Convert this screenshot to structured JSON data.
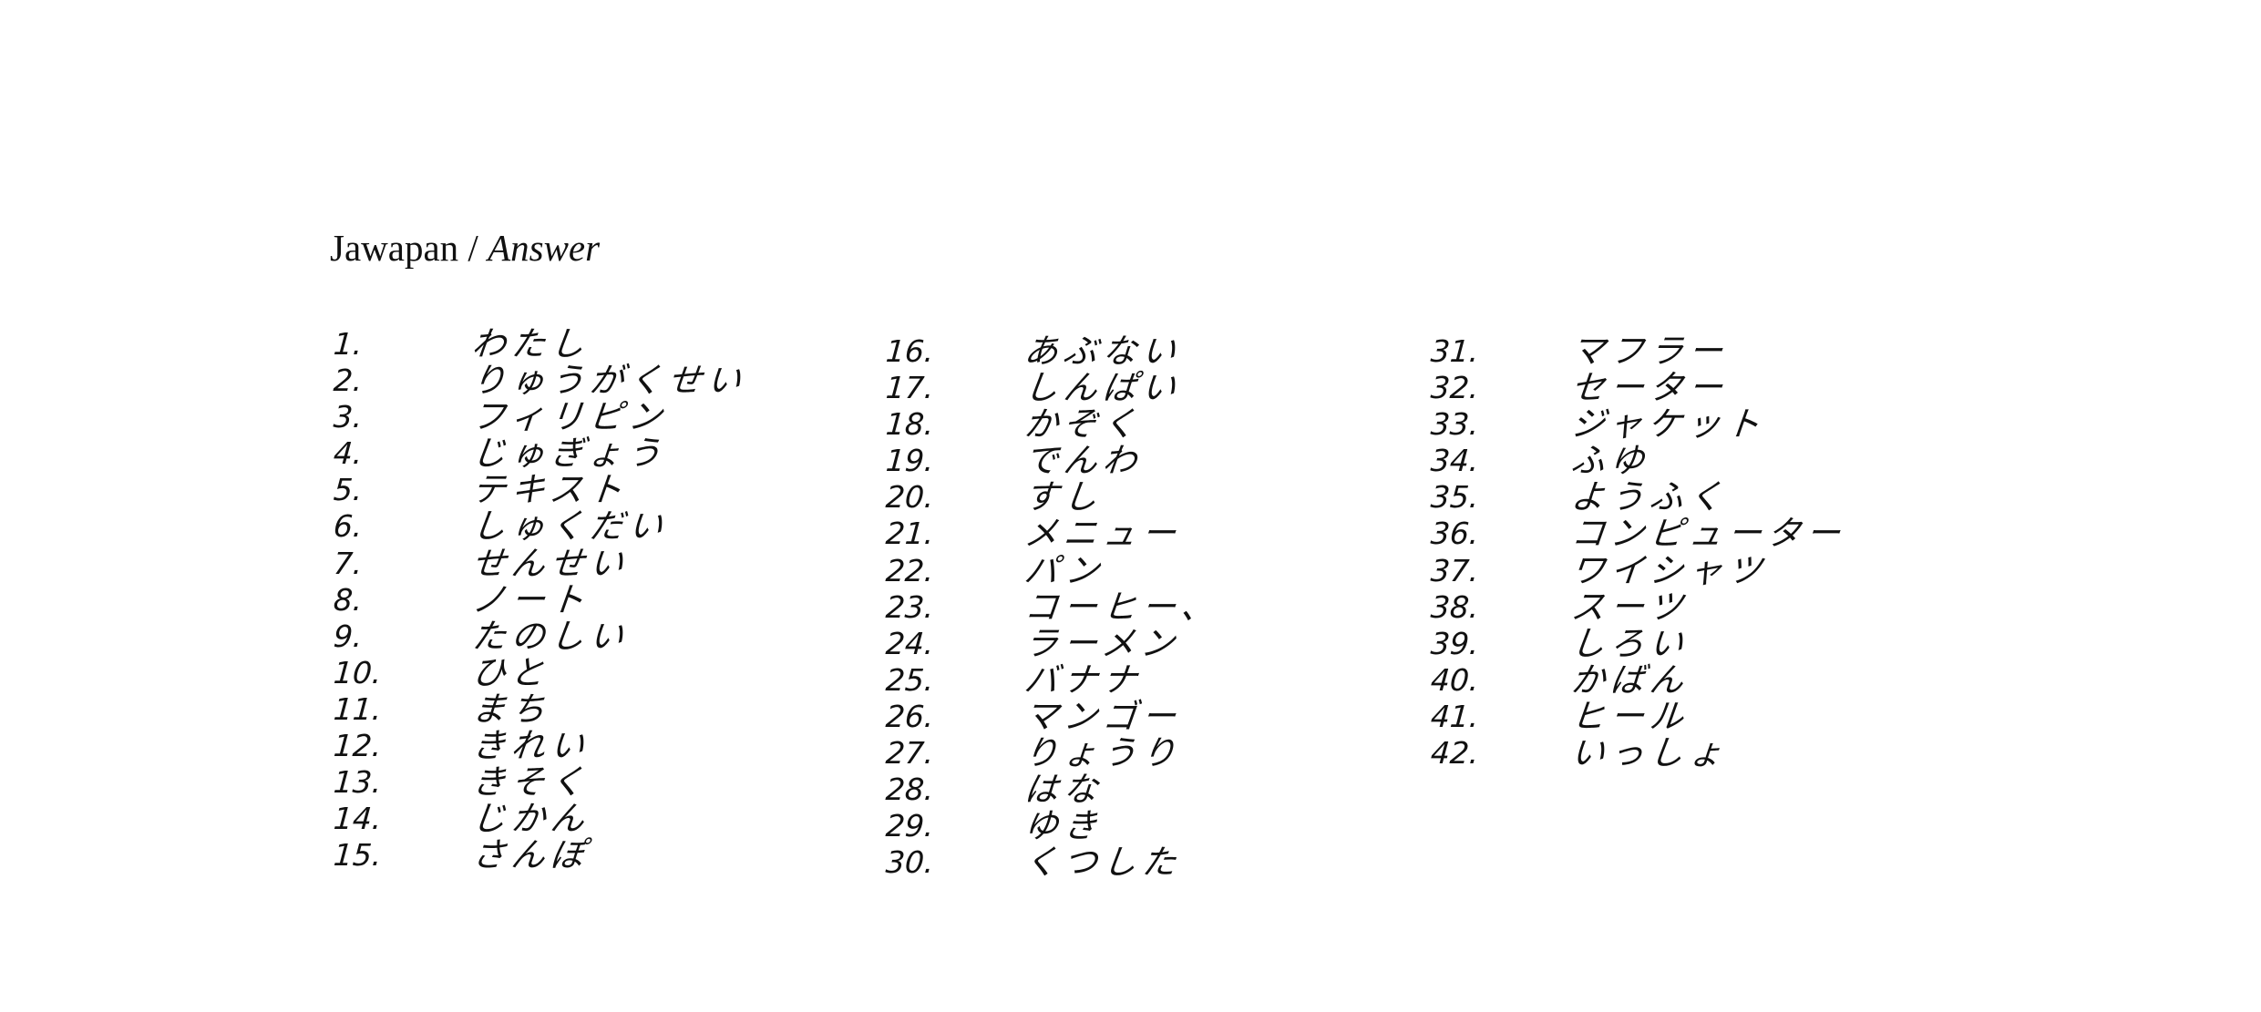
{
  "heading": {
    "main": "Jawapan / ",
    "italic": "Answer"
  },
  "columns": [
    {
      "items": [
        {
          "num": "1.",
          "word": "わたし"
        },
        {
          "num": "2.",
          "word": "りゅうがくせい"
        },
        {
          "num": "3.",
          "word": "フィリピン"
        },
        {
          "num": "4.",
          "word": "じゅぎょう"
        },
        {
          "num": "5.",
          "word": "テキスト"
        },
        {
          "num": "6.",
          "word": "しゅくだい"
        },
        {
          "num": "7.",
          "word": "せんせい"
        },
        {
          "num": "8.",
          "word": "ノート"
        },
        {
          "num": "9.",
          "word": "たのしい"
        },
        {
          "num": "10.",
          "word": "ひと"
        },
        {
          "num": "11.",
          "word": "まち"
        },
        {
          "num": "12.",
          "word": "きれい"
        },
        {
          "num": "13.",
          "word": "きそく"
        },
        {
          "num": "14.",
          "word": "じかん"
        },
        {
          "num": "15.",
          "word": "さんぽ"
        }
      ]
    },
    {
      "items": [
        {
          "num": "16.",
          "word": "あぶない"
        },
        {
          "num": "17.",
          "word": "しんぱい"
        },
        {
          "num": "18.",
          "word": "かぞく"
        },
        {
          "num": "19.",
          "word": "でんわ"
        },
        {
          "num": "20.",
          "word": "すし"
        },
        {
          "num": "21.",
          "word": "メニュー"
        },
        {
          "num": "22.",
          "word": "パン"
        },
        {
          "num": "23.",
          "word": "コーヒー、"
        },
        {
          "num": "24.",
          "word": "ラーメン"
        },
        {
          "num": "25.",
          "word": "バナナ"
        },
        {
          "num": "26.",
          "word": "マンゴー"
        },
        {
          "num": "27.",
          "word": "りょうり"
        },
        {
          "num": "28.",
          "word": "はな"
        },
        {
          "num": "29.",
          "word": "ゆき"
        },
        {
          "num": "30.",
          "word": "くつした"
        }
      ]
    },
    {
      "items": [
        {
          "num": "31.",
          "word": "マフラー"
        },
        {
          "num": "32.",
          "word": "セーター"
        },
        {
          "num": "33.",
          "word": "ジャケット"
        },
        {
          "num": "34.",
          "word": "ふゆ"
        },
        {
          "num": "35.",
          "word": "ようふく"
        },
        {
          "num": "36.",
          "word": "コンピューター"
        },
        {
          "num": "37.",
          "word": "ワイシャツ"
        },
        {
          "num": "38.",
          "word": "スーツ"
        },
        {
          "num": "39.",
          "word": "しろい"
        },
        {
          "num": "40.",
          "word": "かばん"
        },
        {
          "num": "41.",
          "word": "ヒール"
        },
        {
          "num": "42.",
          "word": "いっしょ"
        }
      ]
    }
  ]
}
